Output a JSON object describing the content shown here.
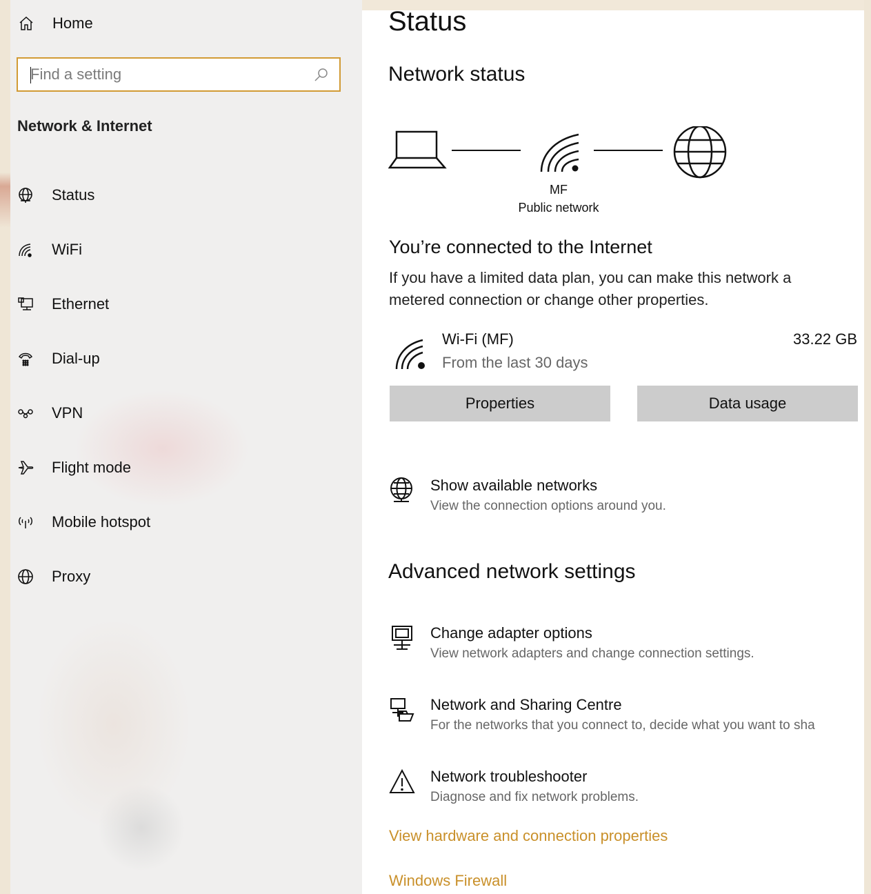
{
  "sidebar": {
    "home_label": "Home",
    "search": {
      "placeholder": "Find a setting"
    },
    "section_title": "Network & Internet",
    "items": [
      {
        "label": "Status",
        "icon": "globe-icon"
      },
      {
        "label": "WiFi",
        "icon": "wifi-icon"
      },
      {
        "label": "Ethernet",
        "icon": "ethernet-icon"
      },
      {
        "label": "Dial-up",
        "icon": "dial-up-icon"
      },
      {
        "label": "VPN",
        "icon": "vpn-icon"
      },
      {
        "label": "Flight mode",
        "icon": "airplane-icon"
      },
      {
        "label": "Mobile hotspot",
        "icon": "hotspot-icon"
      },
      {
        "label": "Proxy",
        "icon": "globe-icon"
      }
    ]
  },
  "main": {
    "title": "Status",
    "network_status_heading": "Network status",
    "network_name": "MF",
    "network_type": "Public network",
    "connected_title": "You’re connected to the Internet",
    "connected_desc": "If you have a limited data plan, you can make this network a metered connection or change other properties.",
    "usage": {
      "name": "Wi-Fi (MF)",
      "period": "From the last 30 days",
      "amount": "33.22 GB"
    },
    "buttons": {
      "properties": "Properties",
      "data_usage": "Data usage"
    },
    "show_networks": {
      "title": "Show available networks",
      "desc": "View the connection options around you."
    },
    "advanced_heading": "Advanced network settings",
    "adapter": {
      "title": "Change adapter options",
      "desc": "View network adapters and change connection settings."
    },
    "sharing": {
      "title": "Network and Sharing Centre",
      "desc": "For the networks that you connect to, decide what you want to sha"
    },
    "troubleshooter": {
      "title": "Network troubleshooter",
      "desc": "Diagnose and fix network problems."
    },
    "links": {
      "hardware": "View hardware and connection properties",
      "firewall": "Windows Firewall"
    }
  },
  "colors": {
    "accent": "#c9902a",
    "search_border": "#d19a33",
    "button_bg": "#cccccc"
  }
}
